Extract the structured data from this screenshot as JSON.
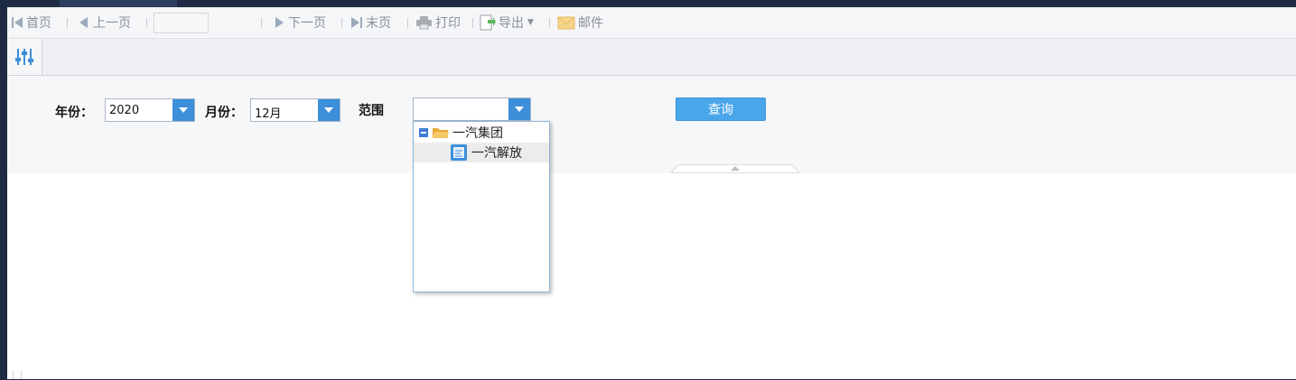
{
  "toolbar": {
    "first_label": "首页",
    "prev_label": "上一页",
    "page_value": "",
    "next_label": "下一页",
    "last_label": "末页",
    "print_label": "打印",
    "export_label": "导出",
    "mail_label": "邮件"
  },
  "form": {
    "year_label": "年份：",
    "year_value": "2020",
    "month_label": "月份：",
    "month_value": "12月",
    "range_label": "范围",
    "range_value": "",
    "query_label": "查询"
  },
  "tree": {
    "root_label": "一汽集团",
    "child_label": "一汽解放"
  },
  "colors": {
    "accent": "#3d8fd9",
    "query_button": "#4aa6ea",
    "background": "#1e2b44"
  }
}
